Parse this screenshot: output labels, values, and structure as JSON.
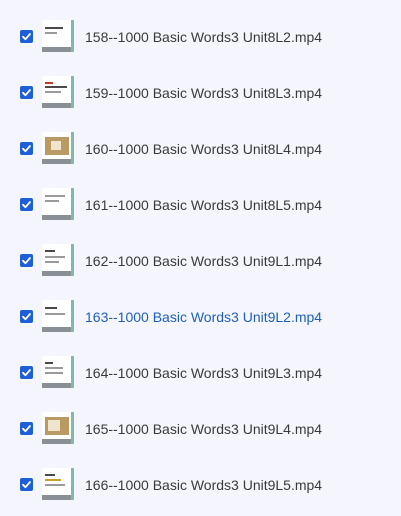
{
  "colors": {
    "background": "#f5f6fd",
    "checkbox": "#1f5fd6",
    "text": "#3a3a3a",
    "active_text": "#1f5fb8",
    "thumb_accent": "#7fb9b1"
  },
  "files": [
    {
      "name": "158--1000 Basic Words3 Unit8L2.mp4",
      "checked": true,
      "active": false,
      "thumb_icon": "video-thumbnail-icon"
    },
    {
      "name": "159--1000 Basic Words3 Unit8L3.mp4",
      "checked": true,
      "active": false,
      "thumb_icon": "video-thumbnail-icon"
    },
    {
      "name": "160--1000 Basic Words3 Unit8L4.mp4",
      "checked": true,
      "active": false,
      "thumb_icon": "video-thumbnail-icon"
    },
    {
      "name": "161--1000 Basic Words3 Unit8L5.mp4",
      "checked": true,
      "active": false,
      "thumb_icon": "video-thumbnail-icon"
    },
    {
      "name": "162--1000 Basic Words3 Unit9L1.mp4",
      "checked": true,
      "active": false,
      "thumb_icon": "video-thumbnail-icon"
    },
    {
      "name": "163--1000 Basic Words3 Unit9L2.mp4",
      "checked": true,
      "active": true,
      "thumb_icon": "video-thumbnail-icon"
    },
    {
      "name": "164--1000 Basic Words3 Unit9L3.mp4",
      "checked": true,
      "active": false,
      "thumb_icon": "video-thumbnail-icon"
    },
    {
      "name": "165--1000 Basic Words3 Unit9L4.mp4",
      "checked": true,
      "active": false,
      "thumb_icon": "video-thumbnail-icon"
    },
    {
      "name": "166--1000 Basic Words3 Unit9L5.mp4",
      "checked": true,
      "active": false,
      "thumb_icon": "video-thumbnail-icon"
    }
  ]
}
